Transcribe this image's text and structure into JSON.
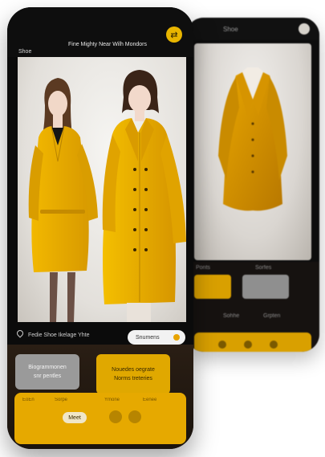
{
  "colors": {
    "accent_yellow": "#e6a900",
    "phone_body": "#0b0b0b",
    "coat": "#e8b000"
  },
  "front": {
    "header": {
      "back": "Shoe",
      "title": "Fine Mighty Near Wilh Mondors",
      "action_icon": "swap-icon"
    },
    "location": "Fedie Shoe Ikelage Yhte",
    "pill": "Snumens",
    "cards": {
      "grey": "Biogrammonen\nsnr pentles",
      "yellow": "Nouedes oegrate\nNorms treteries"
    },
    "bar": {
      "labels": [
        "EoEn",
        "Sorpe",
        "Ymone",
        "Eenee"
      ],
      "chip": "Meet"
    }
  },
  "back": {
    "title": "Shoe",
    "labels": [
      "Ponts",
      "Sorfes",
      "Sohhe",
      "Grpten"
    ]
  }
}
